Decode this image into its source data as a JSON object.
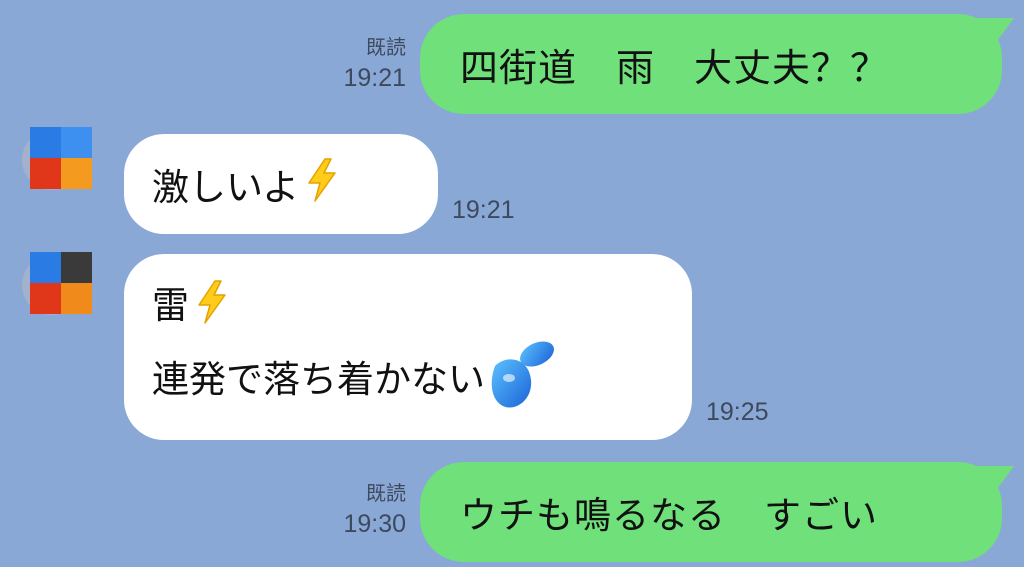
{
  "messages": [
    {
      "direction": "out",
      "text": "四街道　雨　大丈夫？？",
      "read": "既読",
      "time": "19:21"
    },
    {
      "direction": "in",
      "text": "激しいよ",
      "emoji": "high-voltage-icon",
      "time": "19:21"
    },
    {
      "direction": "in",
      "line1": "雷",
      "line1_emoji": "high-voltage-icon",
      "line2": "連発で落ち着かない",
      "line2_emoji": "sweat-droplets-icon",
      "time": "19:25"
    },
    {
      "direction": "out",
      "text": "ウチも鳴るなる　すごい",
      "read": "既読",
      "time": "19:30"
    }
  ],
  "colors": {
    "background": "#8aa8d6",
    "outgoing_bubble": "#6fe07a",
    "incoming_bubble": "#ffffff",
    "meta_text": "#3d4a5e",
    "avatar_blue": "#2a7be4",
    "avatar_lightblue": "#3d8ff0",
    "avatar_red": "#e0361a",
    "avatar_orange": "#f39a1f",
    "avatar_dark": "#3a3a3a"
  }
}
